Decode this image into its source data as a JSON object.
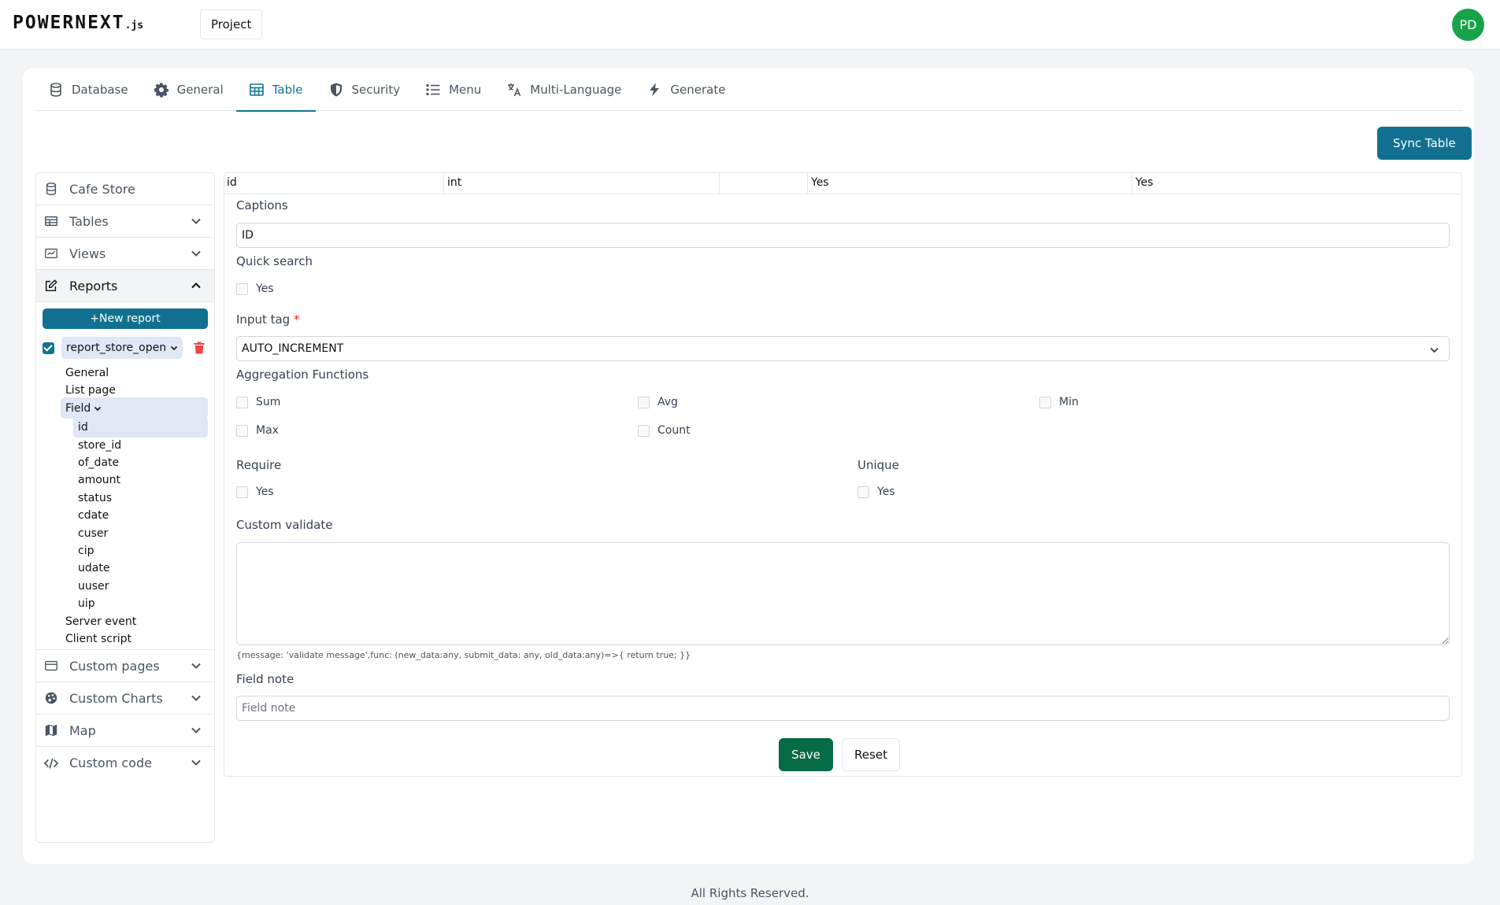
{
  "header": {
    "logo_text": "POWERNEXT",
    "logo_suffix": ".js",
    "project_label": "Project",
    "avatar_initials": "PD",
    "avatar_color": "#16a34a"
  },
  "tabs": [
    {
      "label": "Database",
      "icon": "database-icon"
    },
    {
      "label": "General",
      "icon": "gear-icon"
    },
    {
      "label": "Table",
      "icon": "table-icon",
      "active": true
    },
    {
      "label": "Security",
      "icon": "shield-icon"
    },
    {
      "label": "Menu",
      "icon": "list-icon"
    },
    {
      "label": "Multi-Language",
      "icon": "translate-icon"
    },
    {
      "label": "Generate",
      "icon": "bolt-icon"
    }
  ],
  "sync_label": "Sync Table",
  "sidebar": {
    "database_name": "Cafe Store",
    "tables_label": "Tables",
    "views_label": "Views",
    "reports_label": "Reports",
    "new_report_label": "+New report",
    "report_name": "report_store_open",
    "report_tree": [
      "General",
      "List page"
    ],
    "field_label": "Field",
    "fields": [
      "id",
      "store_id",
      "of_date",
      "amount",
      "status",
      "cdate",
      "cuser",
      "cip",
      "udate",
      "uuser",
      "uip"
    ],
    "after_fields": [
      "Server event",
      "Client script"
    ],
    "custom_pages_label": "Custom pages",
    "custom_charts_label": "Custom Charts",
    "map_label": "Map",
    "custom_code_label": "Custom code"
  },
  "field_row": {
    "name": "id",
    "type": "int",
    "empty": "",
    "col4": "Yes",
    "col5": "Yes"
  },
  "form": {
    "captions_label": "Captions",
    "captions_value": "ID",
    "quick_search_label": "Quick search",
    "quick_search_option": "Yes",
    "input_tag_label": "Input tag",
    "required_mark": "*",
    "input_tag_value": "AUTO_INCREMENT",
    "aggregation_label": "Aggregation Functions",
    "agg_sum": "Sum",
    "agg_avg": "Avg",
    "agg_min": "Min",
    "agg_max": "Max",
    "agg_count": "Count",
    "require_label": "Require",
    "require_option": "Yes",
    "unique_label": "Unique",
    "unique_option": "Yes",
    "custom_validate_label": "Custom validate",
    "custom_validate_hint": "{message: 'validate message',func: (new_data:any, submit_data: any, old_data:any)=>{ return true; }}",
    "field_note_label": "Field note",
    "field_note_placeholder": "Field note",
    "save_label": "Save",
    "reset_label": "Reset"
  },
  "footer_text": "All Rights Reserved."
}
